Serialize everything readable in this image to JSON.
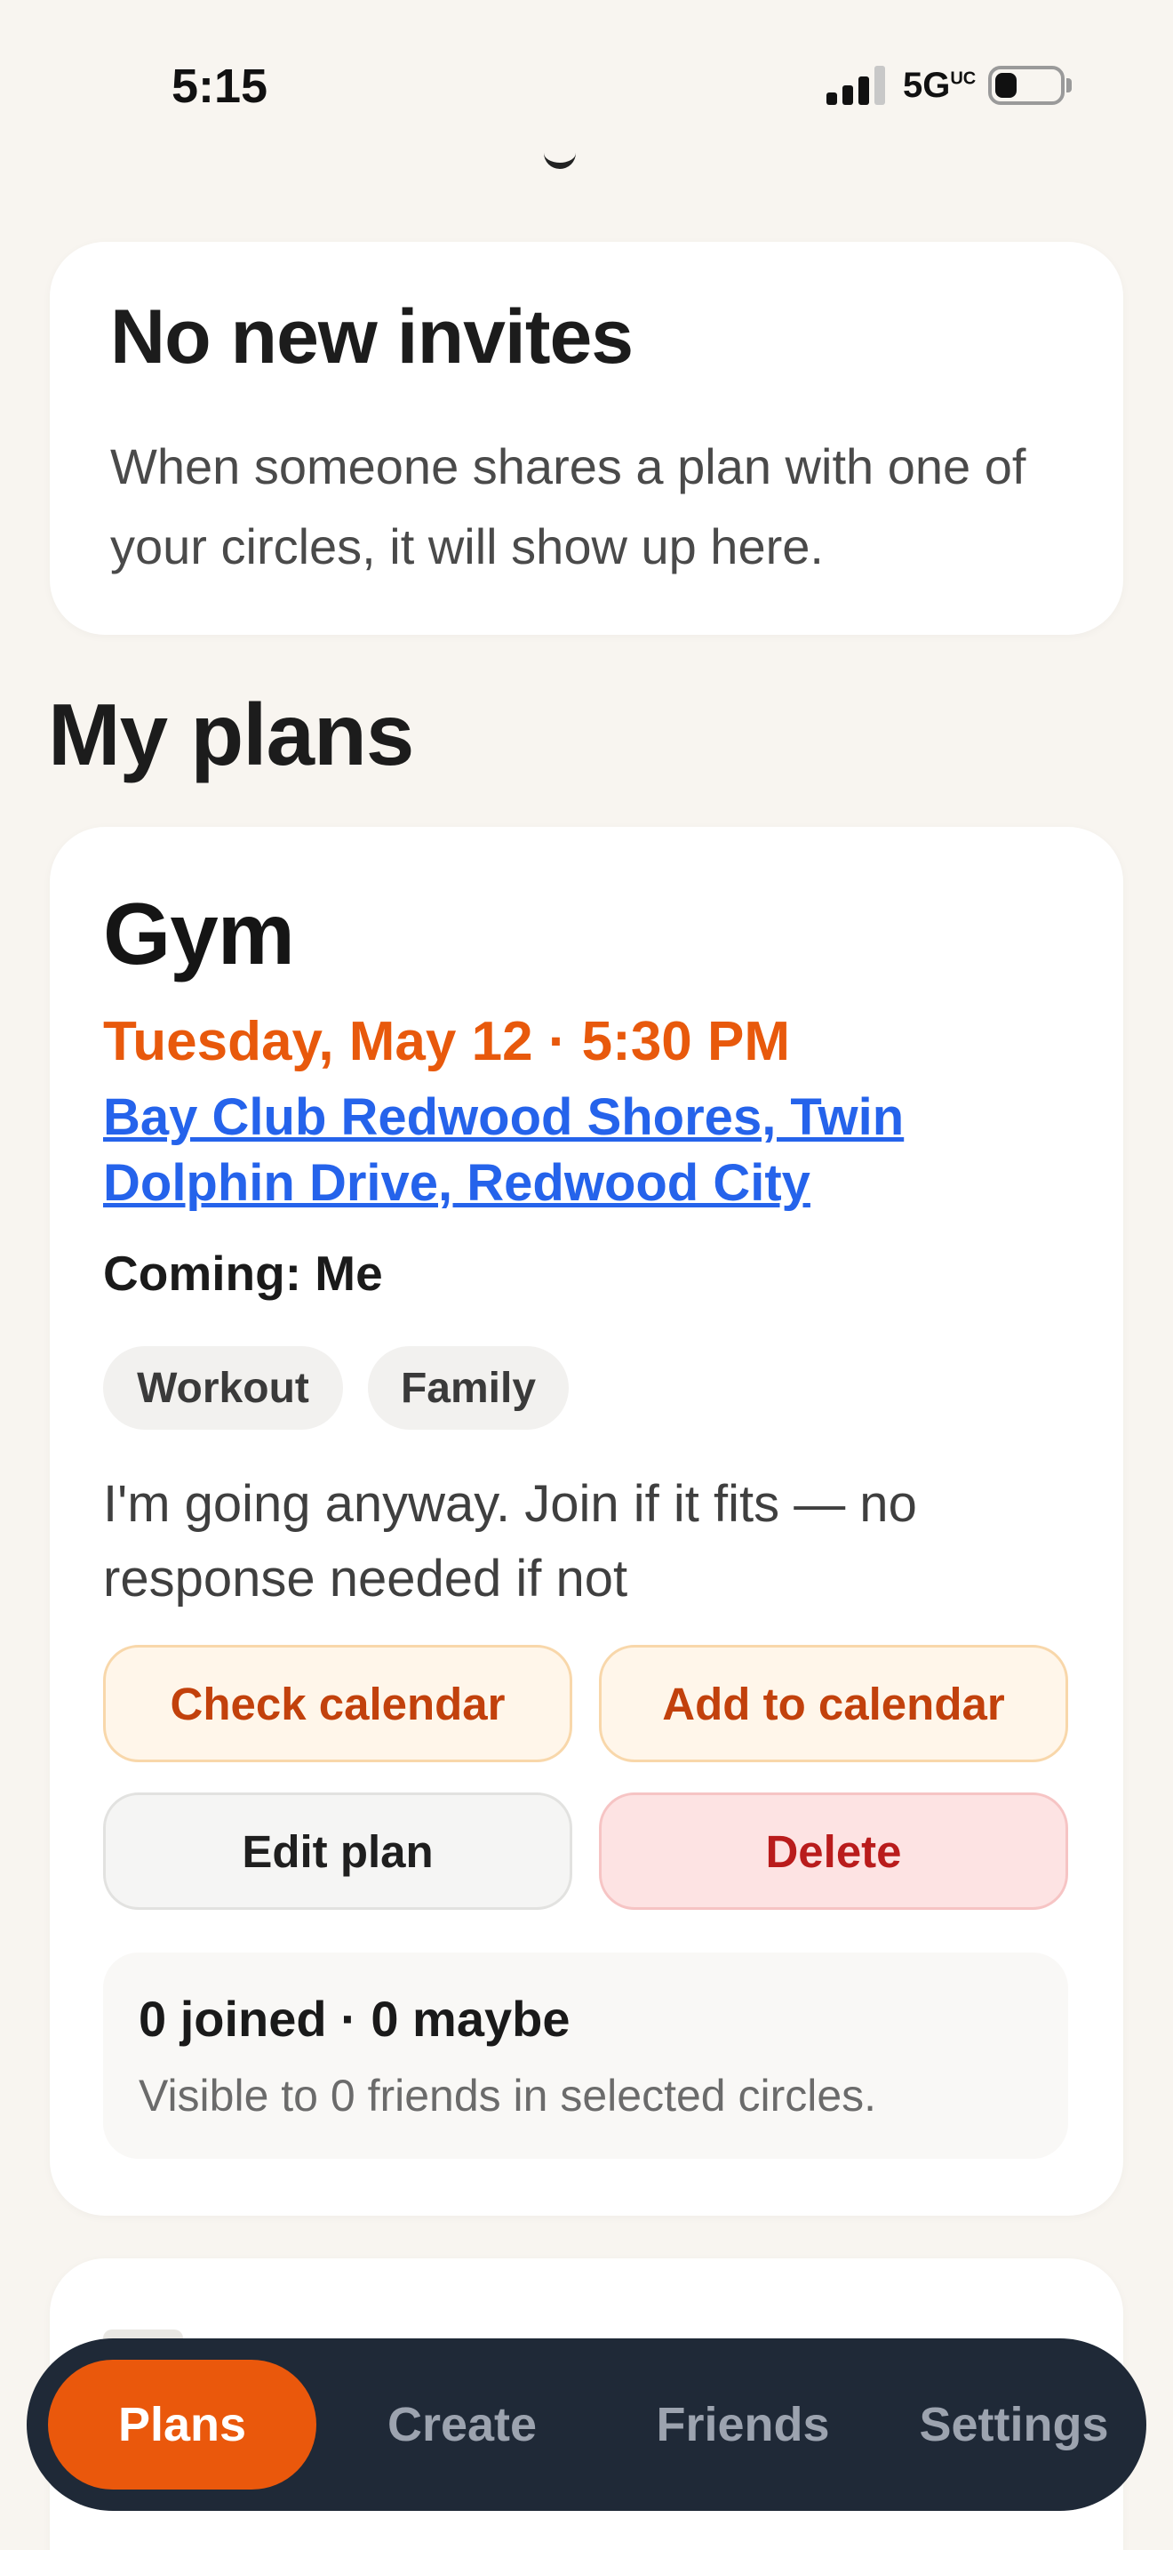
{
  "status_bar": {
    "time": "5:15",
    "network": "5G",
    "network_sup": "UC",
    "icons": [
      "signal-icon",
      "battery-icon"
    ]
  },
  "invites": {
    "title": "No new invites",
    "text": "When someone shares a plan with one of your circles, it will show up here."
  },
  "my_plans": {
    "title": "My plans",
    "plans": [
      {
        "title": "Gym",
        "datetime": "Tuesday, May 12 · 5:30 PM",
        "location": "Bay Club Redwood Shores, Twin Dolphin Drive, Redwood City",
        "coming": "Coming: Me",
        "tags": [
          "Workout",
          "Family"
        ],
        "note": "I'm going anyway. Join if it fits — no response needed if not",
        "buttons": {
          "check_calendar": "Check calendar",
          "add_to_calendar": "Add to calendar",
          "edit": "Edit plan",
          "delete": "Delete"
        },
        "stats": {
          "counts": "0 joined · 0 maybe",
          "visibility": "Visible to 0 friends in selected circles."
        }
      }
    ]
  },
  "tab_bar": {
    "tabs": [
      "Plans",
      "Create",
      "Friends",
      "Settings"
    ],
    "active": "Plans"
  },
  "colors": {
    "accent": "#ea580c",
    "datetime": "#e8590c",
    "link": "#2563eb",
    "delete": "#b91c1c",
    "tab_bar_bg": "#1f2937",
    "page_bg": "#f8f5f0"
  }
}
